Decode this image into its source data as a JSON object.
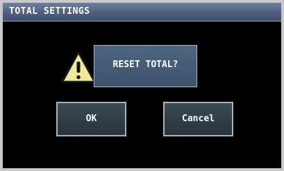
{
  "title_bar": {
    "title": "TOTAL SETTINGS"
  },
  "dialog": {
    "icon": "warning-icon",
    "message": "RESET TOTAL?"
  },
  "buttons": {
    "ok_label": "OK",
    "cancel_label": "Cancel"
  },
  "colors": {
    "screen_background": "#000000",
    "title_bar": "#4e5f80",
    "message_box": "#475d76",
    "button_fill": "#323f48",
    "button_border": "#a9b3bd",
    "warning_fill": "#f1e89a"
  }
}
